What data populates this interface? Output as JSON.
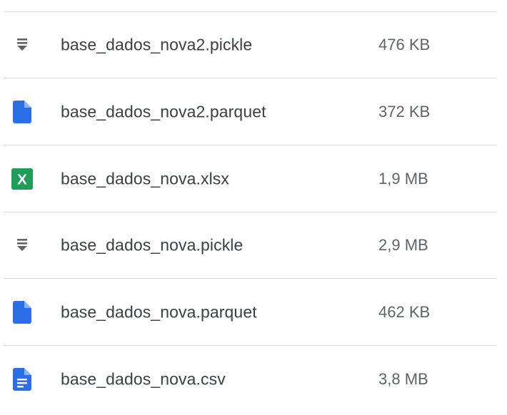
{
  "files": [
    {
      "name": "base_dados_nova2.pickle",
      "size": "476 KB",
      "icon": "generic-file-icon"
    },
    {
      "name": "base_dados_nova2.parquet",
      "size": "372 KB",
      "icon": "blue-file-icon"
    },
    {
      "name": "base_dados_nova.xlsx",
      "size": "1,9 MB",
      "icon": "excel-icon",
      "icon_letter": "X"
    },
    {
      "name": "base_dados_nova.pickle",
      "size": "2,9 MB",
      "icon": "generic-file-icon"
    },
    {
      "name": "base_dados_nova.parquet",
      "size": "462 KB",
      "icon": "blue-file-icon"
    },
    {
      "name": "base_dados_nova.csv",
      "size": "3,8 MB",
      "icon": "text-document-icon"
    }
  ],
  "colors": {
    "blue_file": "#2a6ee8",
    "excel_green": "#1e9e58",
    "generic_gray": "#5f6368",
    "divider": "#dadce0"
  }
}
